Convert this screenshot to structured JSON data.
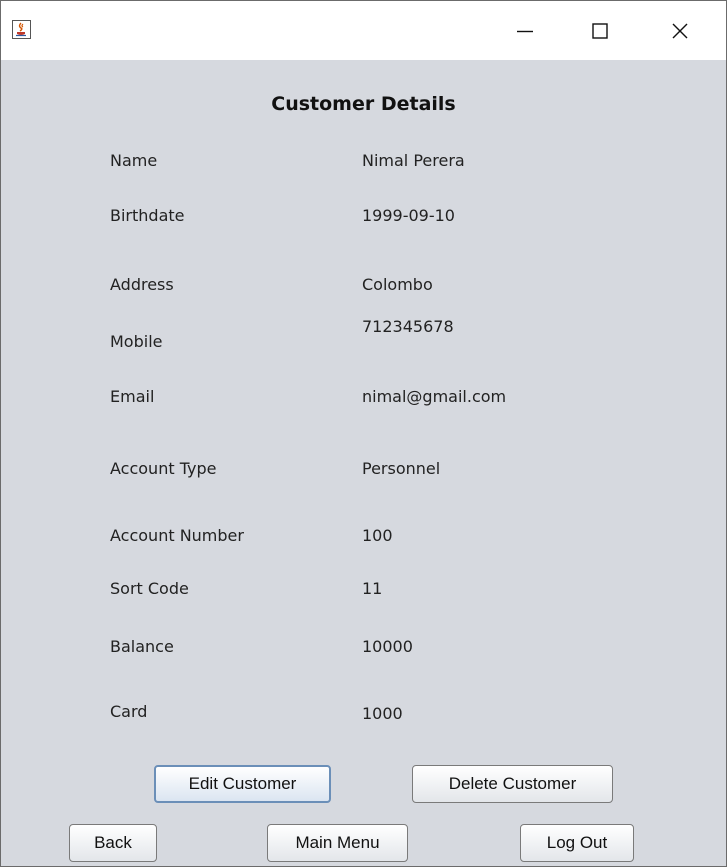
{
  "window": {
    "controls": {
      "minimize_icon": "minimize-icon",
      "maximize_icon": "maximize-icon",
      "close_icon": "close-icon"
    },
    "app_icon": "java-cup-icon"
  },
  "page": {
    "heading": "Customer Details"
  },
  "details": [
    {
      "label": "Name",
      "value": "Nimal Perera"
    },
    {
      "label": "Birthdate",
      "value": "1999-09-10"
    },
    {
      "label": "Address",
      "value": "Colombo"
    },
    {
      "label": "Mobile",
      "value": "712345678"
    },
    {
      "label": "Email",
      "value": "nimal@gmail.com"
    },
    {
      "label": "Account Type",
      "value": "Personnel"
    },
    {
      "label": "Account Number",
      "value": "100"
    },
    {
      "label": "Sort Code",
      "value": "11"
    },
    {
      "label": "Balance",
      "value": "10000"
    },
    {
      "label": "Card",
      "value": "1000"
    }
  ],
  "buttons": {
    "edit": "Edit Customer",
    "delete": "Delete Customer",
    "back": "Back",
    "main_menu": "Main Menu",
    "logout": "Log Out"
  },
  "colors": {
    "window_bg": "#d6d9df",
    "titlebar_bg": "#ffffff",
    "focus_border": "#6b8fb8"
  }
}
